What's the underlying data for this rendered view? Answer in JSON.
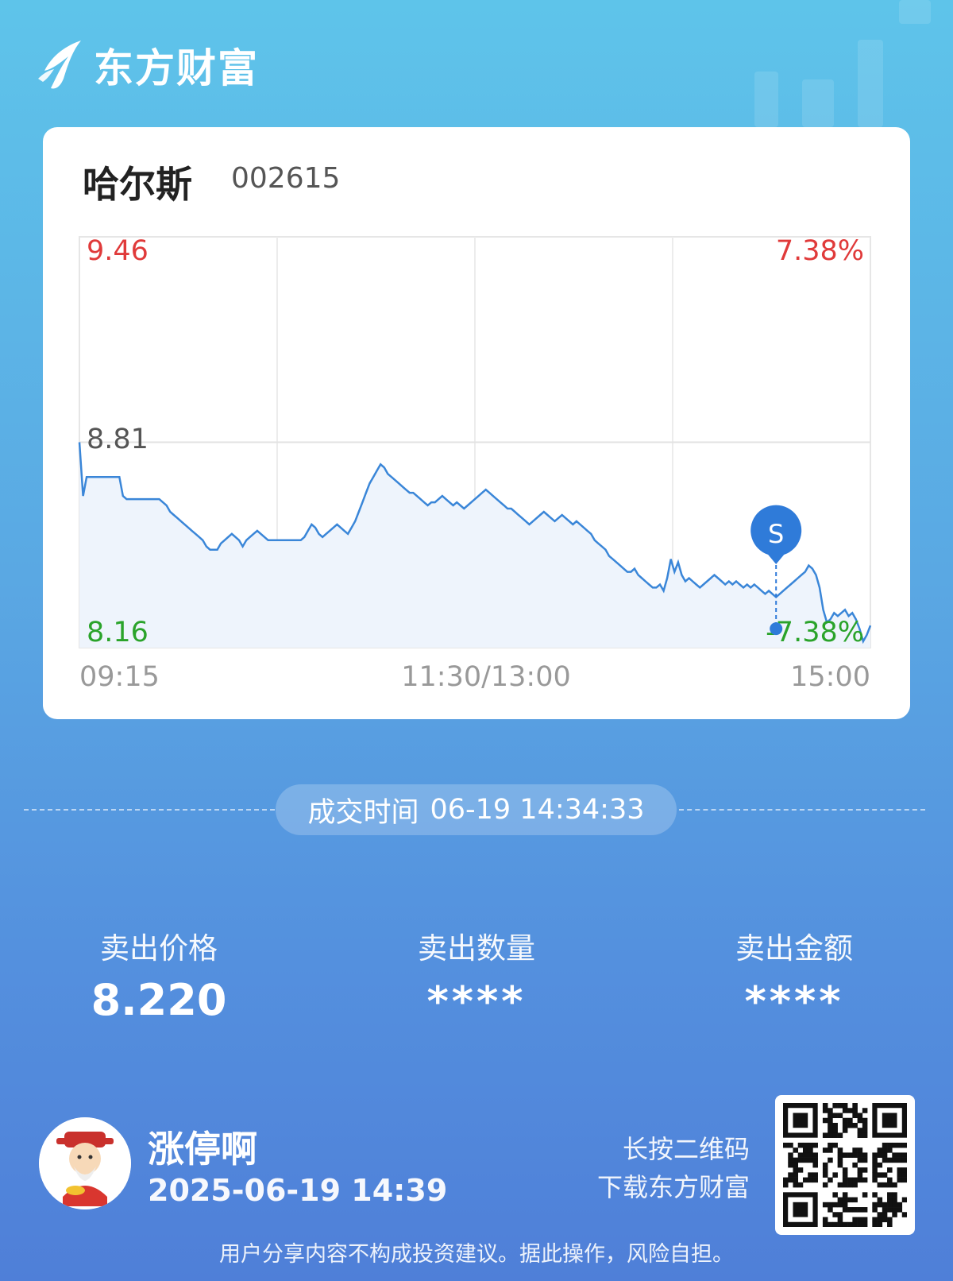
{
  "brand": {
    "name": "东方财富",
    "logo_icon": "eastmoney-logo-icon"
  },
  "stock": {
    "name": "哈尔斯",
    "code": "002615"
  },
  "chart_data": {
    "type": "line",
    "price_axis": {
      "top": "9.46",
      "mid": "8.81",
      "bottom": "8.16"
    },
    "pct_axis": {
      "top": "7.38%",
      "bottom": "-7.38%"
    },
    "x_ticks": [
      "09:15",
      "11:30/13:00",
      "15:00"
    ],
    "ylim": [
      8.16,
      9.46
    ],
    "prev_close": 8.81,
    "colors": {
      "up": "#e03a3a",
      "down": "#2aa32a",
      "line": "#3a86d8",
      "fill": "#eef4fc",
      "marker": "#2f7bd9"
    },
    "sell_marker": {
      "label": "S",
      "time_index": 192,
      "price": 8.22
    },
    "series": [
      {
        "values": [
          8.81,
          8.64,
          8.7,
          8.7,
          8.7,
          8.7,
          8.7,
          8.7,
          8.7,
          8.7,
          8.7,
          8.7,
          8.64,
          8.63,
          8.63,
          8.63,
          8.63,
          8.63,
          8.63,
          8.63,
          8.63,
          8.63,
          8.63,
          8.62,
          8.61,
          8.59,
          8.58,
          8.57,
          8.56,
          8.55,
          8.54,
          8.53,
          8.52,
          8.51,
          8.5,
          8.48,
          8.47,
          8.47,
          8.47,
          8.49,
          8.5,
          8.51,
          8.52,
          8.51,
          8.5,
          8.48,
          8.5,
          8.51,
          8.52,
          8.53,
          8.52,
          8.51,
          8.5,
          8.5,
          8.5,
          8.5,
          8.5,
          8.5,
          8.5,
          8.5,
          8.5,
          8.5,
          8.51,
          8.53,
          8.55,
          8.54,
          8.52,
          8.51,
          8.52,
          8.53,
          8.54,
          8.55,
          8.54,
          8.53,
          8.52,
          8.54,
          8.56,
          8.59,
          8.62,
          8.65,
          8.68,
          8.7,
          8.72,
          8.74,
          8.73,
          8.71,
          8.7,
          8.69,
          8.68,
          8.67,
          8.66,
          8.65,
          8.65,
          8.64,
          8.63,
          8.62,
          8.61,
          8.62,
          8.62,
          8.63,
          8.64,
          8.63,
          8.62,
          8.61,
          8.62,
          8.61,
          8.6,
          8.61,
          8.62,
          8.63,
          8.64,
          8.65,
          8.66,
          8.65,
          8.64,
          8.63,
          8.62,
          8.61,
          8.6,
          8.6,
          8.59,
          8.58,
          8.57,
          8.56,
          8.55,
          8.56,
          8.57,
          8.58,
          8.59,
          8.58,
          8.57,
          8.56,
          8.57,
          8.58,
          8.57,
          8.56,
          8.55,
          8.56,
          8.55,
          8.54,
          8.53,
          8.52,
          8.5,
          8.49,
          8.48,
          8.47,
          8.45,
          8.44,
          8.43,
          8.42,
          8.41,
          8.4,
          8.4,
          8.41,
          8.39,
          8.38,
          8.37,
          8.36,
          8.35,
          8.35,
          8.36,
          8.34,
          8.38,
          8.44,
          8.4,
          8.43,
          8.39,
          8.37,
          8.38,
          8.37,
          8.36,
          8.35,
          8.36,
          8.37,
          8.38,
          8.39,
          8.38,
          8.37,
          8.36,
          8.37,
          8.36,
          8.37,
          8.36,
          8.35,
          8.36,
          8.35,
          8.36,
          8.35,
          8.34,
          8.33,
          8.34,
          8.33,
          8.32,
          8.33,
          8.34,
          8.35,
          8.36,
          8.37,
          8.38,
          8.39,
          8.4,
          8.42,
          8.41,
          8.39,
          8.35,
          8.28,
          8.24,
          8.25,
          8.27,
          8.26,
          8.27,
          8.28,
          8.26,
          8.27,
          8.25,
          8.22,
          8.18,
          8.2,
          8.23
        ]
      }
    ]
  },
  "trade_time": {
    "label": "成交时间",
    "value": "06-19 14:34:33"
  },
  "stats": [
    {
      "label": "卖出价格",
      "value": "8.220"
    },
    {
      "label": "卖出数量",
      "value": "****"
    },
    {
      "label": "卖出金额",
      "value": "****"
    }
  ],
  "user": {
    "name": "涨停啊",
    "time": "2025-06-19 14:39",
    "avatar_icon": "caishen-avatar-icon"
  },
  "qr": {
    "line1": "长按二维码",
    "line2": "下载东方财富",
    "icon": "qr-code-icon"
  },
  "disclaimer": "用户分享内容不构成投资建议。据此操作，风险自担。"
}
